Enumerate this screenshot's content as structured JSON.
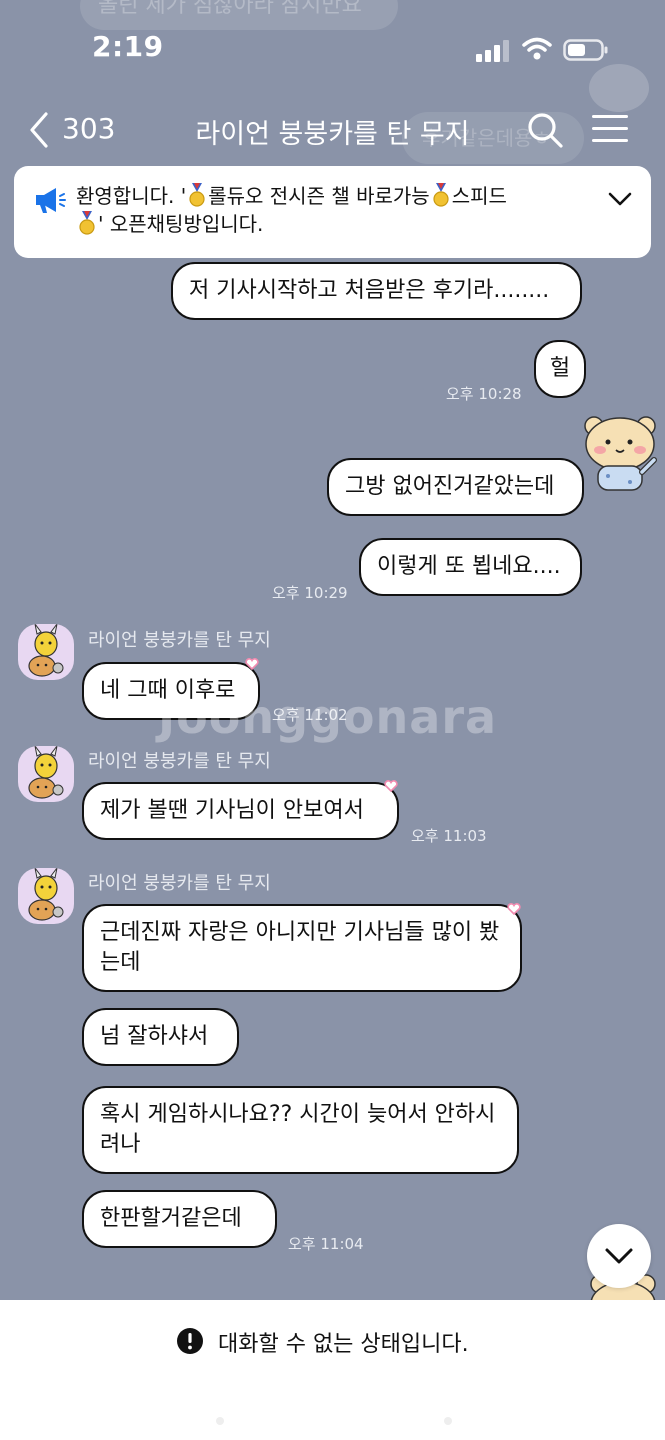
{
  "status_bar": {
    "time": "2:19"
  },
  "header": {
    "back_count": "303",
    "title": "라이언 붕붕카를 탄 무지"
  },
  "notice": {
    "text_parts": [
      "환영합니다. '",
      "롤듀오 전시즌 챌 바로가능",
      "스피드",
      "' 오픈채팅방입니다."
    ]
  },
  "ghost": {
    "top": "올린 제가 점잖아라 잠시만요",
    "bubble": "후기같은데용ㅎ"
  },
  "messages": {
    "m1": "저 기사시작하고 처음받은 후기라........",
    "m2": "헐",
    "t1": "오후 10:28",
    "m3": "그방 없어진거같았는데",
    "m4": "이렇게 또 뵙네요....",
    "t2": "오후 10:29",
    "name1": "라이언 붕붕카를 탄 무지",
    "m5": "네 그때 이후로",
    "t3": "오후 11:02",
    "name2": "라이언 붕붕카를 탄 무지",
    "m6": "제가 볼땐 기사님이 안보여서",
    "t4": "오후 11:03",
    "name3": "라이언 붕붕카를 탄 무지",
    "m7": "근데진짜 자랑은 아니지만 기사님들 많이 봤는데",
    "m8": "넘 잘하샤서",
    "m9": "혹시 게임하시나요?? 시간이 늦어서 안하시려나",
    "m10": "한판할거같은데",
    "t5": "오후 11:04"
  },
  "watermark": "Joonggonara",
  "bottom": {
    "status": "대화할 수 없는 상태입니다."
  },
  "colors": {
    "background": "#8a93a8",
    "bubble": "#ffffff",
    "notice_icon": "#1a73e8",
    "heart": "#f28bb0",
    "avatar_bg": "#e8d8f2"
  },
  "icons": [
    "back-chevron-icon",
    "search-icon",
    "menu-icon",
    "megaphone-icon",
    "medal-icon",
    "chevron-down-icon",
    "exclamation-circle-icon",
    "signal-icon",
    "wifi-icon",
    "battery-icon"
  ]
}
